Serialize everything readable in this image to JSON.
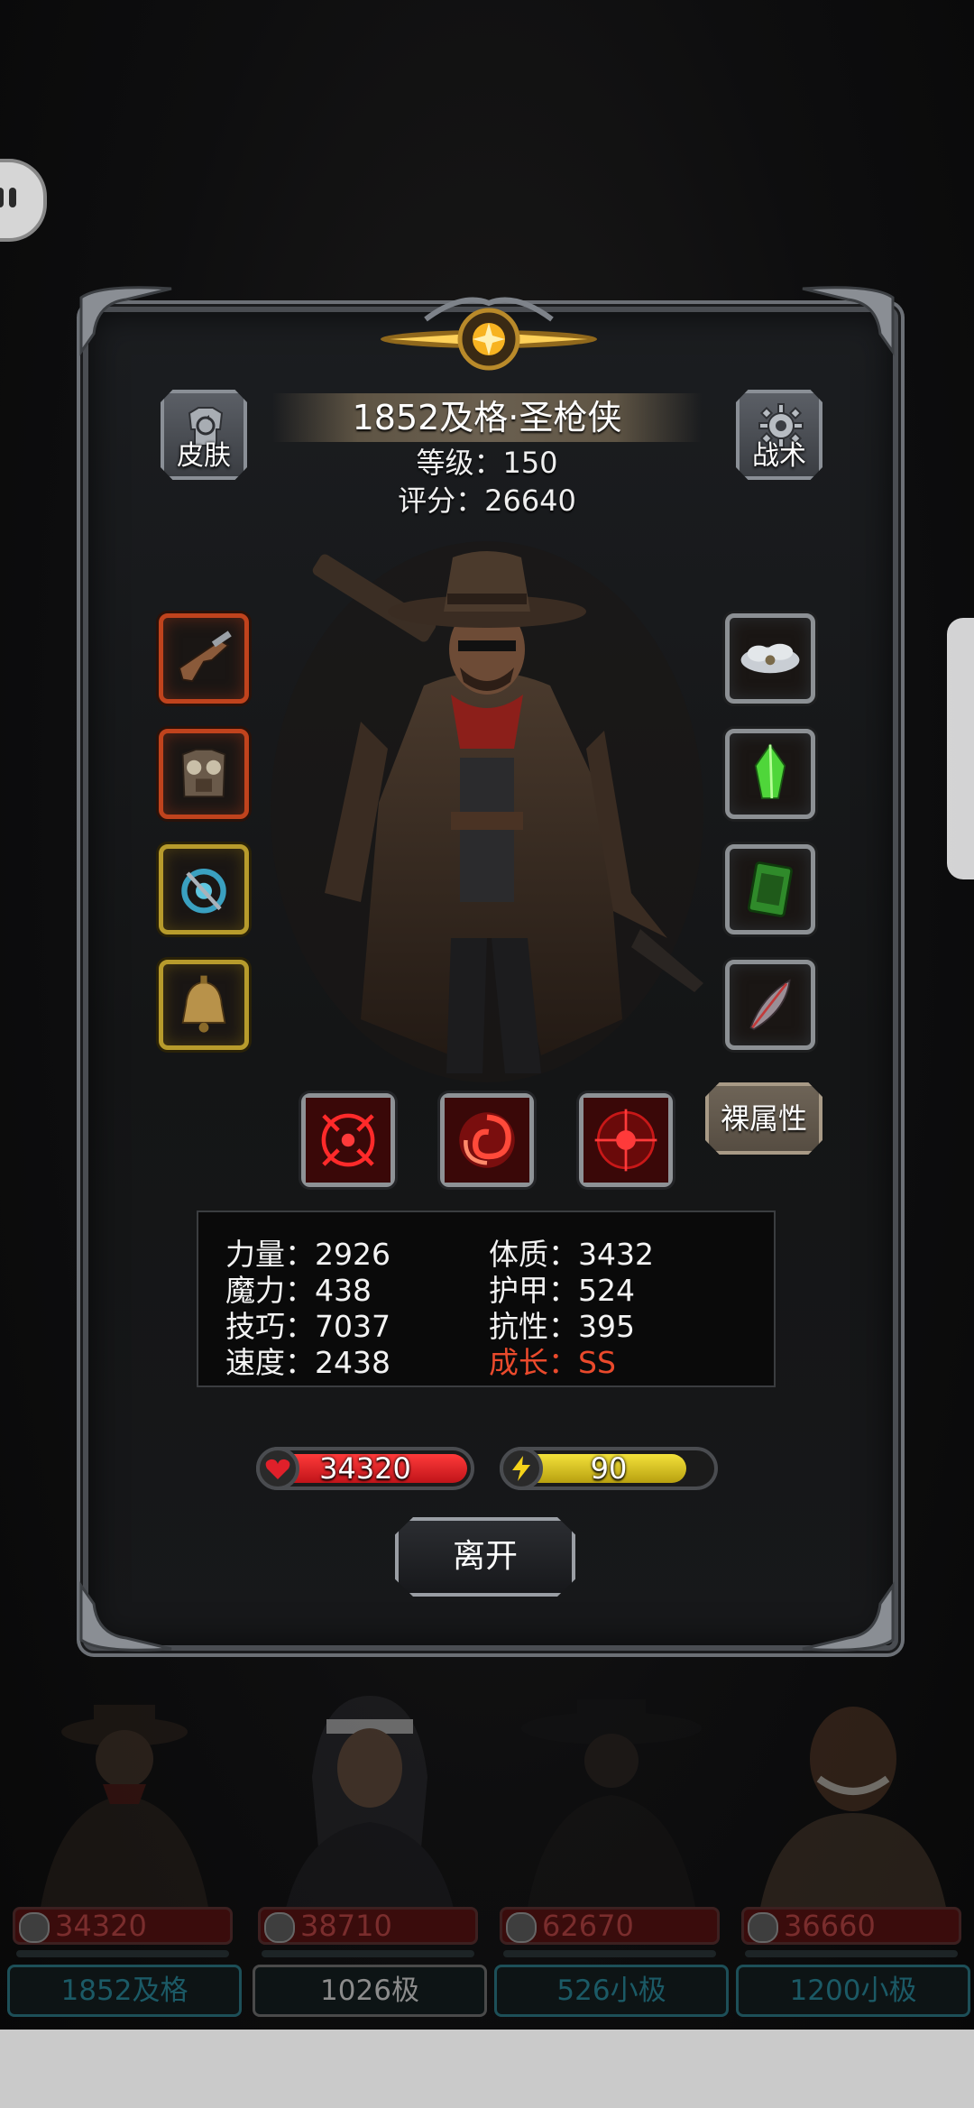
{
  "hero": {
    "name": "1852及格·圣枪侠",
    "level_label": "等级：150",
    "score_label": "评分：26640"
  },
  "buttons": {
    "skin": "皮肤",
    "tactics": "战术",
    "bare_attributes": "裸属性",
    "leave": "离开"
  },
  "stats": {
    "strength": "力量：2926",
    "constitution": "体质：3432",
    "magic": "魔力：438",
    "armor": "护甲：524",
    "skill": "技巧：7037",
    "resistance": "抗性：395",
    "speed": "速度：2438",
    "growth": "成长：SS"
  },
  "bars": {
    "hp": "34320",
    "energy": "90",
    "energy_fraction": 0.88
  },
  "equipment_left": [
    "pistol-icon",
    "chest-armor-icon",
    "amulet-icon",
    "bell-icon"
  ],
  "equipment_right": [
    "cloud-charm-icon",
    "green-crystal-icon",
    "green-card-icon",
    "feather-icon"
  ],
  "skills": [
    "crosshair-skill-icon",
    "vortex-skill-icon",
    "target-skill-icon"
  ],
  "team": [
    {
      "hp": "34320",
      "name": "1852及格"
    },
    {
      "hp": "38710",
      "name": "1026极"
    },
    {
      "hp": "62670",
      "name": "526小极"
    },
    {
      "hp": "36660",
      "name": "1200小极"
    }
  ],
  "colors": {
    "growth_red": "#ea4a2c",
    "hp_red": "#d8141c",
    "energy_yellow": "#d9c21a"
  }
}
